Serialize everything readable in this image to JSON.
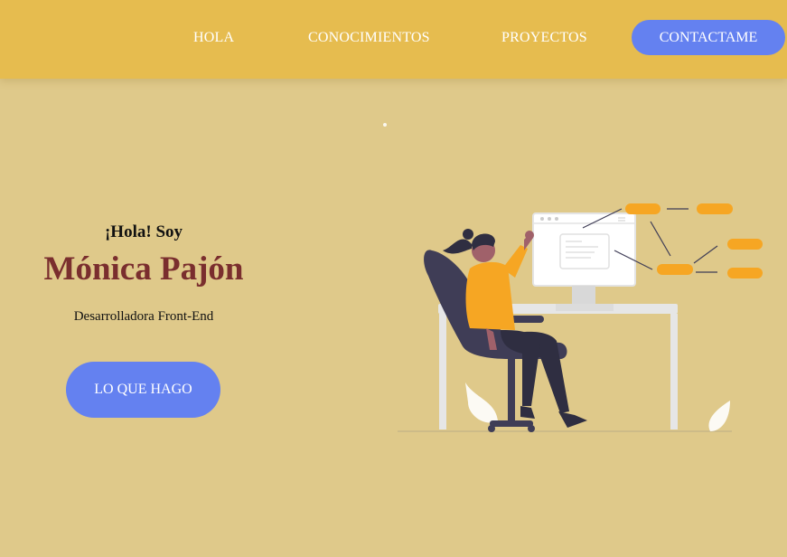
{
  "nav": {
    "links": [
      "HOLA",
      "CONOCIMIENTOS",
      "PROYECTOS"
    ],
    "cta_label": "CONTACTAME"
  },
  "hero": {
    "greeting": "¡Hola! Soy",
    "name": "Mónica Pajón",
    "role": "Desarrolladora Front-End",
    "button_label": "LO QUE HAGO"
  },
  "colors": {
    "page_background": "#dfc98a",
    "navbar_background": "#e6bc4f",
    "button_blue": "#6481f0",
    "name_color": "#7a2e2e",
    "accent_orange": "#f6a623"
  },
  "illustration": {
    "icon": "woman-at-desk-illustration"
  }
}
